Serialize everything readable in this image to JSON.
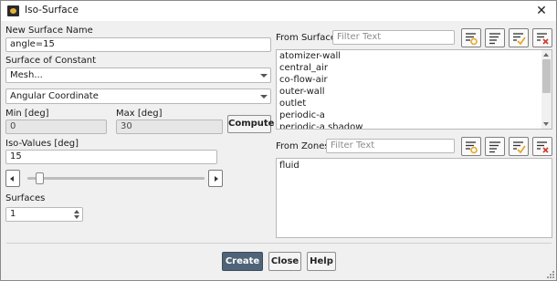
{
  "window": {
    "title": "Iso-Surface",
    "close_glyph": "✕",
    "icons": {
      "app": "fluent-app-icon",
      "close": "close-icon"
    }
  },
  "left": {
    "new_surface_name_label": "New Surface Name",
    "new_surface_name_value": "angle=15",
    "surface_of_constant_label": "Surface of Constant",
    "surface_of_constant_category": "Mesh...",
    "surface_of_constant_quantity": "Angular Coordinate",
    "min_label": "Min [deg]",
    "min_value": "0",
    "max_label": "Max [deg]",
    "max_value": "30",
    "compute_label": "Compute",
    "iso_values_label": "Iso-Values [deg]",
    "iso_values_value": "15",
    "iso_slider_fraction": 0.05,
    "surfaces_label": "Surfaces",
    "surfaces_value": "1"
  },
  "from_surface": {
    "label": "From Surface",
    "filter_placeholder": "Filter Text",
    "items": [
      "atomizer-wall",
      "central_air",
      "co-flow-air",
      "outer-wall",
      "outlet",
      "periodic-a",
      "periodic-a shadow"
    ]
  },
  "from_zones": {
    "label": "From Zones",
    "filter_placeholder": "Filter Text",
    "items": [
      "fluid"
    ]
  },
  "list_tool_icons": [
    "filter-options-icon",
    "sort-list-icon",
    "select-all-icon",
    "deselect-all-icon"
  ],
  "footer": {
    "create_label": "Create",
    "close_label": "Close",
    "help_label": "Help"
  },
  "colors": {
    "primary_button": "#4f6478",
    "accent_yellow": "#e5a92f",
    "deselect_red": "#d0402d"
  }
}
